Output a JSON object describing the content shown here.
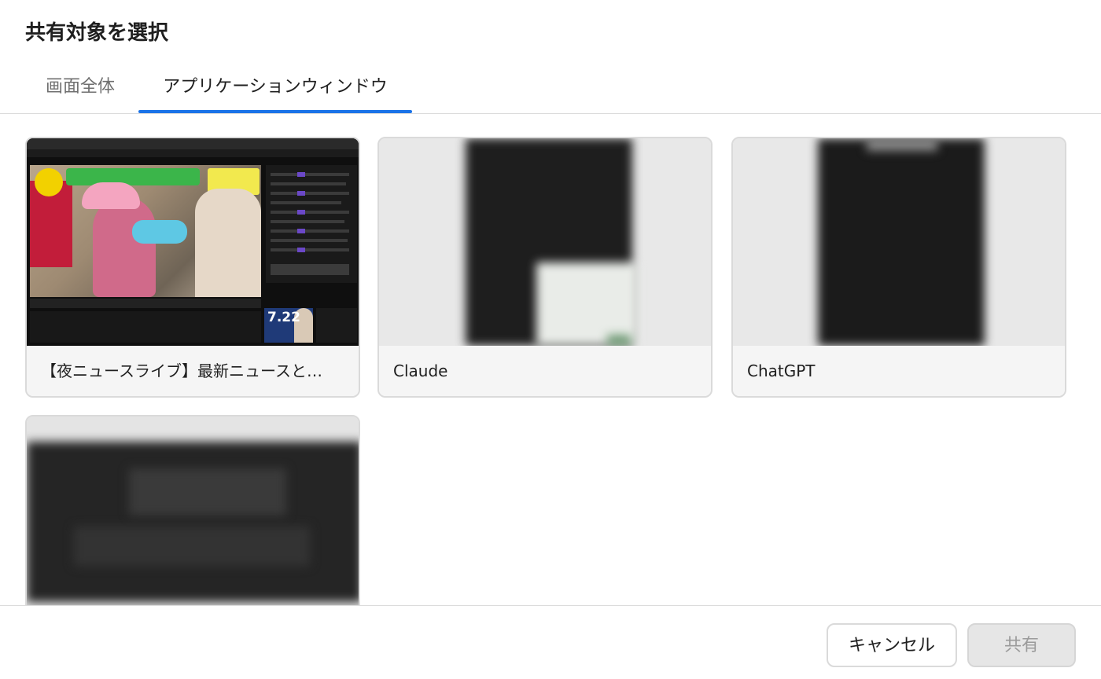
{
  "dialog": {
    "title": "共有対象を選択"
  },
  "tabs": [
    {
      "label": "画面全体",
      "active": false
    },
    {
      "label": "アプリケーションウィンドウ",
      "active": true
    }
  ],
  "windows": [
    {
      "label": "【夜ニュースライブ】最新ニュースと…",
      "thumb_text": "7.22"
    },
    {
      "label": "Claude"
    },
    {
      "label": "ChatGPT"
    },
    {
      "label": ""
    }
  ],
  "footer": {
    "cancel_label": "キャンセル",
    "share_label": "共有"
  },
  "colors": {
    "accent": "#1a73e8",
    "border": "#dadada",
    "disabled_bg": "#e6e6e6",
    "disabled_text": "#9b9b9b"
  }
}
